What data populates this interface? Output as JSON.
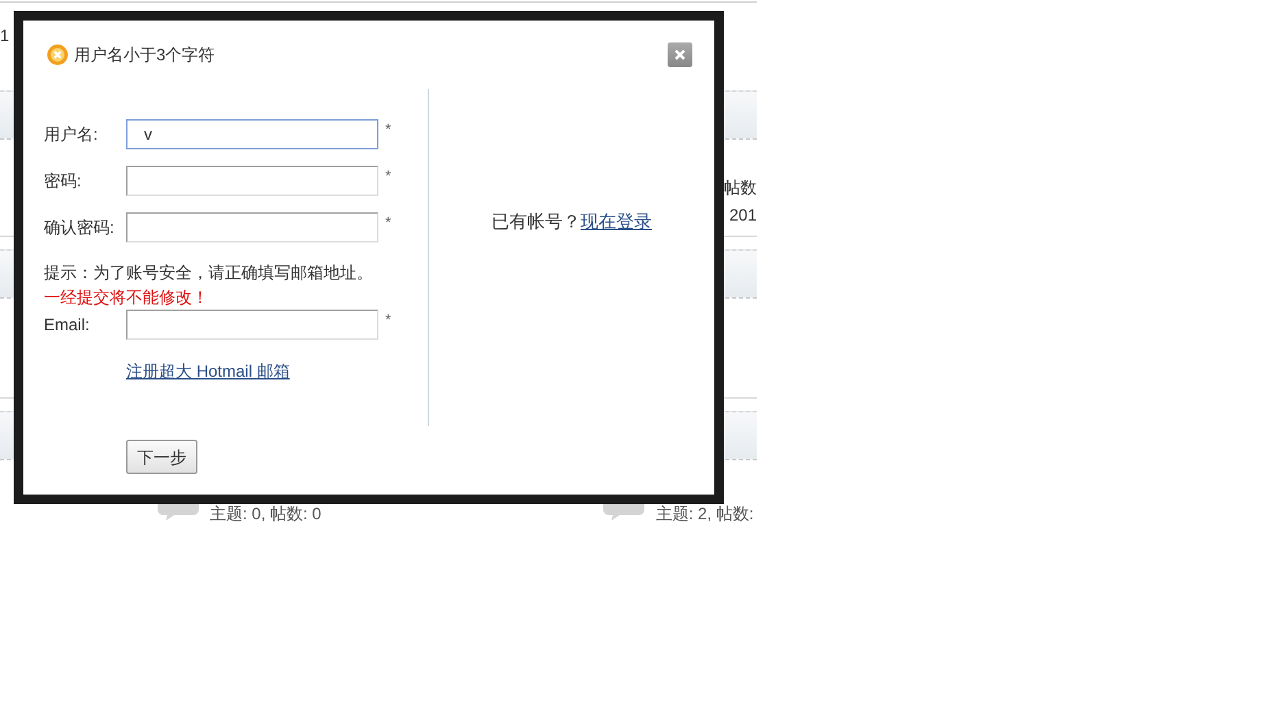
{
  "background": {
    "top_text": "1",
    "side_texts": [
      "帖数",
      "201"
    ],
    "stats": [
      "主题: 0, 帖数: 0",
      "主题: 2, 帖数:"
    ]
  },
  "dialog": {
    "title": "用户名小于3个字符",
    "fields": [
      {
        "label": "用户名:",
        "value": "v",
        "required": "*",
        "focused": true
      },
      {
        "label": "密码:",
        "required": "*",
        "focused": false
      },
      {
        "label": "确认密码:",
        "required": "*",
        "focused": false
      }
    ],
    "hint": "提示：为了账号安全，请正确填写邮箱地址。",
    "warning": "一经提交将不能修改！",
    "email": {
      "label": "Email:",
      "required": "*",
      "focused": false
    },
    "hotmail_link": "注册超大 Hotmail 邮箱",
    "next_button": "下一步",
    "login_prompt": "已有帐号？",
    "login_link": "现在登录"
  }
}
